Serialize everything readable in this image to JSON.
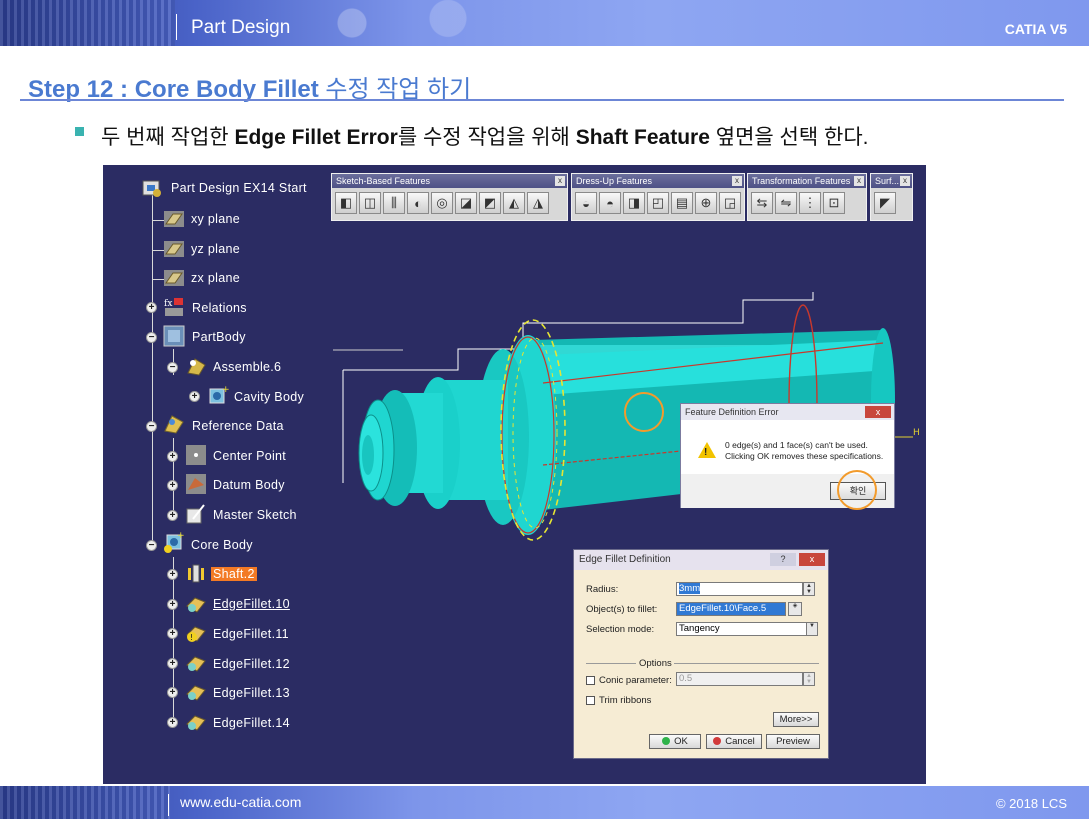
{
  "header": {
    "title": "Part Design",
    "brand": "CATIA V5"
  },
  "footer": {
    "url": "www.edu-catia.com",
    "copyright": "© 2018 LCS"
  },
  "step": {
    "prefix": "Step 12 : Core Body Fillet",
    "suffix": " 수정 작업 하기"
  },
  "instruction": {
    "p1": "두 번째 작업한 ",
    "b1": "Edge Fillet Error",
    "p2": "를 수정 작업을 위해 ",
    "b2": "Shaft Feature",
    "p3": " 옆면을 선택 한다."
  },
  "tree": {
    "root": "Part Design EX14 Start",
    "xy": "xy plane",
    "yz": "yz plane",
    "zx": "zx plane",
    "relations": "Relations",
    "partbody": "PartBody",
    "assemble": "Assemble.6",
    "cavity": "Cavity Body",
    "refdata": "Reference Data",
    "center": "Center Point",
    "datum": "Datum Body",
    "master": "Master Sketch",
    "core": "Core Body",
    "shaft": "Shaft.2",
    "ef10": "EdgeFillet.10",
    "ef11": "EdgeFillet.11",
    "ef12": "EdgeFillet.12",
    "ef13": "EdgeFillet.13",
    "ef14": "EdgeFillet.14"
  },
  "toolbars": {
    "sketch": "Sketch-Based Features",
    "dressup": "Dress-Up Features",
    "transform": "Transformation Features",
    "surf": "Surf...",
    "close": "x"
  },
  "error_dialog": {
    "title": "Feature Definition Error",
    "close": "x",
    "line1": "0 edge(s) and 1 face(s) can't be used.",
    "line2": "Clicking OK removes these specifications.",
    "ok": "확인"
  },
  "fillet_dialog": {
    "title": "Edge Fillet Definition",
    "help": "?",
    "close": "x",
    "radius_label": "Radius:",
    "radius_value": "3mm",
    "objects_label": "Object(s) to fillet:",
    "objects_value": "EdgeFillet.10\\Face.5",
    "mode_label": "Selection mode:",
    "mode_value": "Tangency",
    "options": "Options",
    "conic_label": "Conic parameter:",
    "conic_value": "0.5",
    "trim_label": "Trim ribbons",
    "more": "More>>",
    "ok": "OK",
    "cancel": "Cancel",
    "preview": "Preview"
  },
  "model": {
    "axis_label": "H"
  },
  "colors": {
    "accent": "#4a7ad0",
    "selection": "#f37a25",
    "background": "#2b2c63",
    "part": "#1fd6d0",
    "highlight_ring": "#f29b2c"
  }
}
